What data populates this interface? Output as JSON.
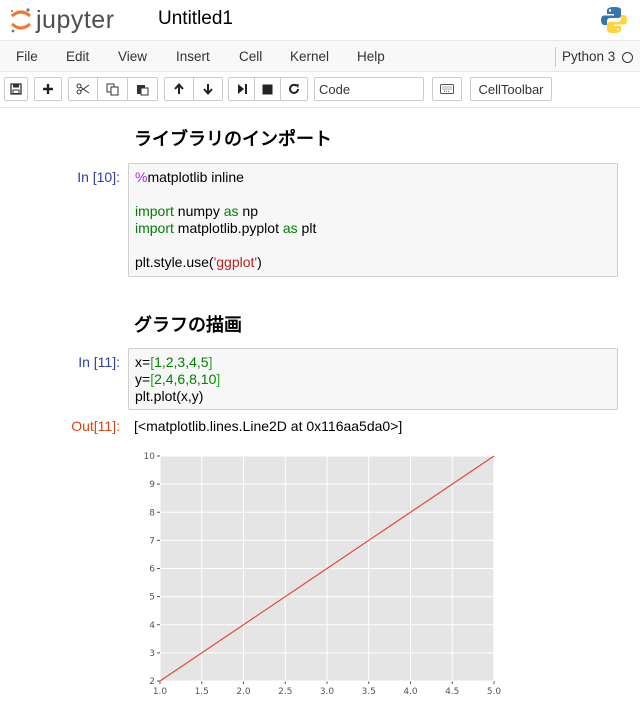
{
  "header": {
    "logo_text": "jupyter",
    "notebook_title": "Untitled1"
  },
  "menubar": {
    "items": [
      "File",
      "Edit",
      "View",
      "Insert",
      "Cell",
      "Kernel",
      "Help"
    ],
    "kernel_name": "Python 3"
  },
  "toolbar": {
    "buttons": [
      "save-icon",
      "plus-icon",
      "cut-icon",
      "copy-icon",
      "paste-icon",
      "arrow-up-icon",
      "arrow-down-icon",
      "run-icon",
      "stop-icon",
      "restart-icon"
    ],
    "cell_type": "Code",
    "keyboard_icon": "keyboard-icon",
    "celltoolbar_label": "CellToolbar"
  },
  "cells": {
    "heading1": "ライブラリのインポート",
    "cell1_prompt": "In [10]:",
    "cell1_lines": {
      "l1_magic": "%",
      "l1_rest": "matplotlib inline",
      "l3_kw1": "import",
      "l3_mod": " numpy ",
      "l3_kw2": "as",
      "l3_alias": " np",
      "l4_kw1": "import",
      "l4_mod": " matplotlib.pyplot ",
      "l4_kw2": "as",
      "l4_alias": " plt",
      "l6_pre": "plt.style.use(",
      "l6_str": "'ggplot'",
      "l6_post": ")"
    },
    "heading2": "グラフの描画",
    "cell2_prompt": "In [11]:",
    "cell2_lines": {
      "l1_pre": "x=",
      "l1_b1": "[",
      "l1_vals": "1,2,3,4,5",
      "l1_b2": "]",
      "l2_pre": "y=",
      "l2_b1": "[",
      "l2_vals": "2,4,6,8,10",
      "l2_b2": "]",
      "l3": "plt.plot(x,y)"
    },
    "out_prompt": "Out[11]:",
    "out_text": "[<matplotlib.lines.Line2D at 0x116aa5da0>]"
  },
  "chart_data": {
    "type": "line",
    "x": [
      1,
      2,
      3,
      4,
      5
    ],
    "series": [
      {
        "values": [
          2,
          4,
          6,
          8,
          10
        ],
        "color": "#e24a33"
      }
    ],
    "xlim": [
      1.0,
      5.0
    ],
    "ylim": [
      2,
      10
    ],
    "xticks": [
      "1.0",
      "1.5",
      "2.0",
      "2.5",
      "3.0",
      "3.5",
      "4.0",
      "4.5",
      "5.0"
    ],
    "yticks": [
      "2",
      "3",
      "4",
      "5",
      "6",
      "7",
      "8",
      "9",
      "10"
    ],
    "grid": true,
    "background": "#e5e5e5"
  }
}
